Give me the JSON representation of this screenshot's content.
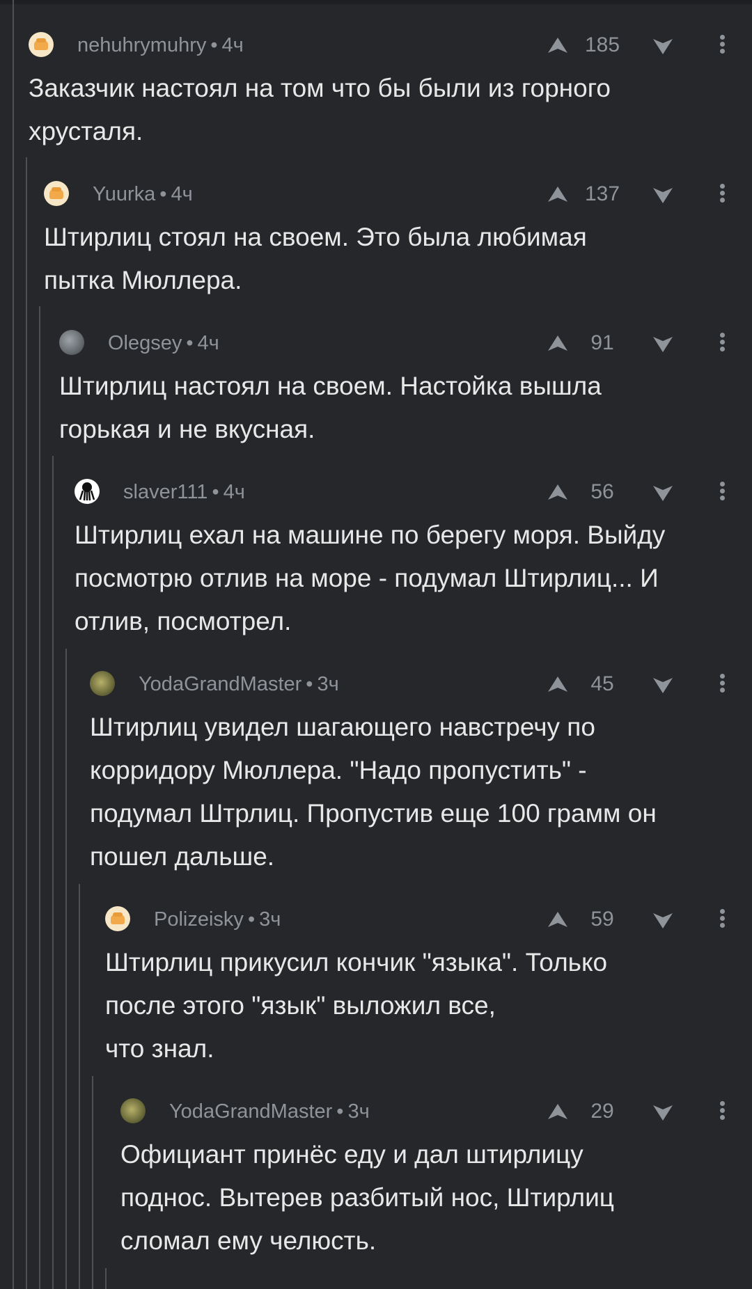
{
  "comments": [
    {
      "author": "nehuhrymuhry",
      "time": "4ч",
      "score": "185",
      "avatar": "default-avatar",
      "text": "Заказчик настоял на том что бы были из горного\nхрусталя."
    },
    {
      "author": "Yuurka",
      "time": "4ч",
      "score": "137",
      "avatar": "default-avatar",
      "text": "Штирлиц стоял на своем. Это была любимая\nпытка Мюллера."
    },
    {
      "author": "Olegsey",
      "time": "4ч",
      "score": "91",
      "avatar": "cat-avatar",
      "text": "Штирлиц настоял на своем. Настойка вышла\nгорькая и не вкусная."
    },
    {
      "author": "slaver111",
      "time": "4ч",
      "score": "56",
      "avatar": "octopus-avatar",
      "text": "Штирлиц ехал на машине по берегу моря. Выйду\nпосмотрю отлив на море - подумал Штирлиц... И\nотлив, посмотрел."
    },
    {
      "author": "YodaGrandMaster",
      "time": "3ч",
      "score": "45",
      "avatar": "yoda-avatar",
      "text": "Штирлиц увидел шагающего навстречу по\nкорридору Мюллера. \"Надо пропустить\" -\nподумал Штрлиц. Пропустив еще 100 грамм он\nпошел дальше."
    },
    {
      "author": "Polizeisky",
      "time": "3ч",
      "score": "59",
      "avatar": "default-avatar",
      "text": "Штирлиц прикусил кончик \"языка\". Только\nпосле этого \"язык\" выложил все,\nчто знал."
    },
    {
      "author": "YodaGrandMaster",
      "time": "3ч",
      "score": "29",
      "avatar": "yoda-avatar",
      "text": "Официант принёс еду и дал штирлицу\nподнос. Вытерев разбитый нос, Штирлиц\nсломал ему челюсть."
    }
  ],
  "colors": {
    "background": "#25272a",
    "thread_line": "#4d5055",
    "meta": "#8f939a",
    "text": "#e8e8e8"
  }
}
